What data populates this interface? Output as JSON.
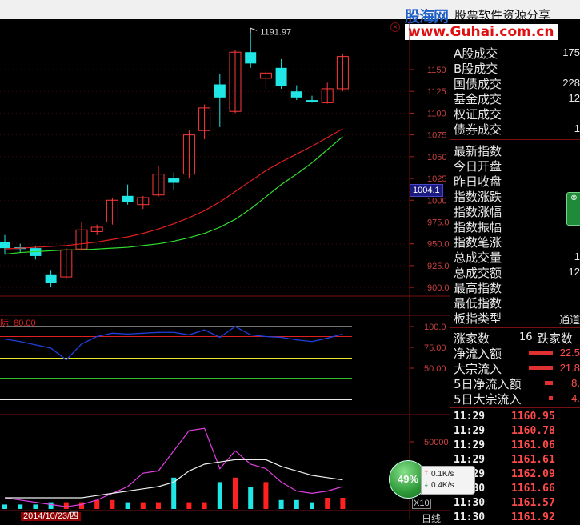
{
  "logo": {
    "brand": "股海网",
    "slogan": "股票软件资源分享",
    "url": "www.Guhai.com.cn"
  },
  "price_axis": [
    "1150",
    "1125",
    "1100",
    "1075",
    "1050",
    "1025",
    "1000",
    "975.0",
    "950.0",
    "925.0",
    "900.0"
  ],
  "high_marker": "1191.97",
  "current_price_tag": "1004.1",
  "indicator": {
    "label": "际: 80.00",
    "axis": [
      "100.0",
      "75.00",
      "50.00"
    ]
  },
  "volume": {
    "axis_label": "50000",
    "multiplier": "X10"
  },
  "date_label": "2014/10/23/四",
  "period_label": "日线",
  "side_button": {
    "label": "⊗"
  },
  "speed": {
    "percent": "49%",
    "up": "0.1K/s",
    "down": "0.4K/s"
  },
  "panel": {
    "trade_rows": [
      {
        "label": "A股成交",
        "value": "175"
      },
      {
        "label": "B股成交",
        "value": ""
      },
      {
        "label": "国债成交",
        "value": "228"
      },
      {
        "label": "基金成交",
        "value": "12"
      },
      {
        "label": "权证成交",
        "value": ""
      },
      {
        "label": "债券成交",
        "value": "1"
      }
    ],
    "index_rows": [
      {
        "label": "最新指数",
        "value": ""
      },
      {
        "label": "今日开盘",
        "value": ""
      },
      {
        "label": "昨日收盘",
        "value": ""
      },
      {
        "label": "指数涨跌",
        "value": ""
      },
      {
        "label": "指数涨幅",
        "value": ""
      },
      {
        "label": "指数振幅",
        "value": ""
      },
      {
        "label": "指数笔涨",
        "value": ""
      },
      {
        "label": "总成交量",
        "value": "1"
      },
      {
        "label": "总成交额",
        "value": "12"
      },
      {
        "label": "最高指数",
        "value": ""
      },
      {
        "label": "最低指数",
        "value": ""
      },
      {
        "label": "板指类型",
        "value": "通道"
      }
    ],
    "breadth": {
      "up_label": "涨家数",
      "up_value": "16",
      "down_label": "跌家数"
    },
    "flows": [
      {
        "label": "净流入额",
        "value": "22.5",
        "bar": 0.6
      },
      {
        "label": "大宗流入",
        "value": "21.8",
        "bar": 0.6
      },
      {
        "label": "5日净流入额",
        "value": "8.",
        "bar": 0.2
      },
      {
        "label": "5日大宗流入",
        "value": "4.",
        "bar": 0.1
      }
    ],
    "ticks": [
      {
        "time": "11:29",
        "price": "1160.95"
      },
      {
        "time": "11:29",
        "price": "1160.78"
      },
      {
        "time": "11:29",
        "price": "1161.06"
      },
      {
        "time": "11:29",
        "price": "1161.61"
      },
      {
        "time": "11:29",
        "price": "1162.09"
      },
      {
        "time": "11:30",
        "price": "1161.66"
      },
      {
        "time": "11:30",
        "price": "1161.57"
      },
      {
        "time": "11:30",
        "price": "1161.92"
      }
    ]
  },
  "chart_data": {
    "type": "candlestick",
    "ylim": [
      890,
      1195
    ],
    "candles": [
      {
        "o": 952,
        "h": 960,
        "l": 938,
        "c": 945,
        "up": false
      },
      {
        "o": 946,
        "h": 950,
        "l": 940,
        "c": 944,
        "up": false
      },
      {
        "o": 945,
        "h": 948,
        "l": 932,
        "c": 936,
        "up": false
      },
      {
        "o": 915,
        "h": 920,
        "l": 900,
        "c": 905,
        "up": false
      },
      {
        "o": 912,
        "h": 945,
        "l": 910,
        "c": 943,
        "up": true
      },
      {
        "o": 944,
        "h": 975,
        "l": 942,
        "c": 966,
        "up": true
      },
      {
        "o": 964,
        "h": 972,
        "l": 960,
        "c": 969,
        "up": true
      },
      {
        "o": 975,
        "h": 1003,
        "l": 972,
        "c": 1000,
        "up": true
      },
      {
        "o": 1005,
        "h": 1018,
        "l": 995,
        "c": 998,
        "up": false
      },
      {
        "o": 995,
        "h": 1005,
        "l": 990,
        "c": 1003,
        "up": true
      },
      {
        "o": 1006,
        "h": 1040,
        "l": 1004,
        "c": 1030,
        "up": true
      },
      {
        "o": 1025,
        "h": 1032,
        "l": 1012,
        "c": 1020,
        "up": false
      },
      {
        "o": 1030,
        "h": 1080,
        "l": 1025,
        "c": 1075,
        "up": true
      },
      {
        "o": 1080,
        "h": 1110,
        "l": 1070,
        "c": 1106,
        "up": true
      },
      {
        "o": 1133,
        "h": 1145,
        "l": 1084,
        "c": 1118,
        "up": false
      },
      {
        "o": 1102,
        "h": 1172,
        "l": 1100,
        "c": 1170,
        "up": true
      },
      {
        "o": 1170,
        "h": 1192,
        "l": 1152,
        "c": 1157,
        "up": false
      },
      {
        "o": 1140,
        "h": 1150,
        "l": 1128,
        "c": 1146,
        "up": true
      },
      {
        "o": 1152,
        "h": 1162,
        "l": 1128,
        "c": 1131,
        "up": false
      },
      {
        "o": 1125,
        "h": 1132,
        "l": 1115,
        "c": 1118,
        "up": false
      },
      {
        "o": 1115,
        "h": 1120,
        "l": 1112,
        "c": 1113,
        "up": false
      },
      {
        "o": 1112,
        "h": 1135,
        "l": 1111,
        "c": 1128,
        "up": true
      },
      {
        "o": 1128,
        "h": 1168,
        "l": 1125,
        "c": 1165,
        "up": true
      }
    ],
    "ma_red": [
      944,
      945,
      946,
      947,
      948,
      950,
      952,
      955,
      958,
      962,
      967,
      973,
      980,
      988,
      998,
      1010,
      1022,
      1034,
      1044,
      1053,
      1062,
      1072,
      1082
    ],
    "ma_green": [
      938,
      940,
      941,
      942,
      943,
      943,
      944,
      945,
      946,
      948,
      950,
      953,
      957,
      962,
      969,
      978,
      990,
      1004,
      1018,
      1030,
      1043,
      1058,
      1073
    ],
    "indicator_line": [
      85,
      82,
      78,
      74,
      60,
      79,
      88,
      92,
      91,
      92,
      93,
      93,
      90,
      96,
      87,
      100,
      90,
      88,
      87,
      84,
      82,
      86,
      91
    ],
    "indicator_levels": [
      100,
      88,
      62,
      38,
      12
    ],
    "volume_bars": [
      2,
      2,
      2,
      3,
      3,
      3,
      4,
      4,
      3,
      3,
      3,
      14,
      3,
      3,
      12,
      14,
      10,
      12,
      4,
      4,
      3,
      5,
      5
    ],
    "volume_ma_purple": [
      5,
      4,
      3,
      2,
      1,
      2,
      4,
      7,
      10,
      16,
      17,
      26,
      35,
      36,
      18,
      26,
      20,
      18,
      12,
      8,
      7,
      8,
      10
    ],
    "volume_ma_white": [
      5,
      5,
      5,
      5,
      5,
      5,
      6,
      7,
      8,
      9,
      10,
      12,
      17,
      20,
      21,
      22,
      22,
      22,
      19,
      17,
      15,
      14,
      13
    ]
  }
}
